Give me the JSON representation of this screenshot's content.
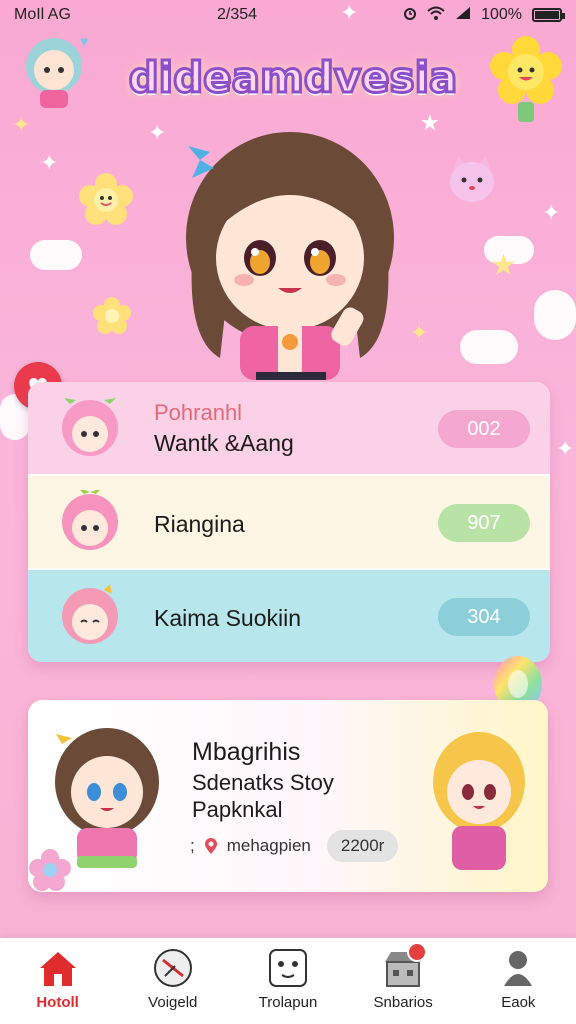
{
  "status_bar": {
    "carrier": "MoIl AG",
    "time": "2/354",
    "battery_text": "100%",
    "battery_level": 1.0
  },
  "app": {
    "title": "dideamdvesia"
  },
  "list": {
    "items": [
      {
        "top_label": "Pohranhl",
        "name": "Wantk &Aang",
        "score": "002",
        "row_color": "#fbd1e8",
        "pill_color": "#f4a7cf"
      },
      {
        "top_label": "",
        "name": "Riangina",
        "score": "907",
        "row_color": "#fdf6e4",
        "pill_color": "#b9e3a6"
      },
      {
        "top_label": "",
        "name": "Kaima Suokiin",
        "score": "304",
        "row_color": "#b7e6ec",
        "pill_color": "#8ccfd9"
      }
    ]
  },
  "story": {
    "line1": "Mbagrihis",
    "line2": "Sdenatks Stoy",
    "line3": "Papknkal",
    "meta_bullet": ";",
    "meta_text": "mehagpien",
    "count": "2200r"
  },
  "tabs": [
    {
      "label": "Hotoll",
      "icon": "home-icon",
      "active": true
    },
    {
      "label": "Voigeld",
      "icon": "compass-icon",
      "active": false
    },
    {
      "label": "Trolapun",
      "icon": "dice-face-icon",
      "active": false
    },
    {
      "label": "Snbarios",
      "icon": "shop-icon",
      "active": false
    },
    {
      "label": "Eaok",
      "icon": "profile-icon",
      "active": false
    }
  ],
  "colors": {
    "accent": "#e02c2c",
    "background": "#f9a9d2"
  }
}
